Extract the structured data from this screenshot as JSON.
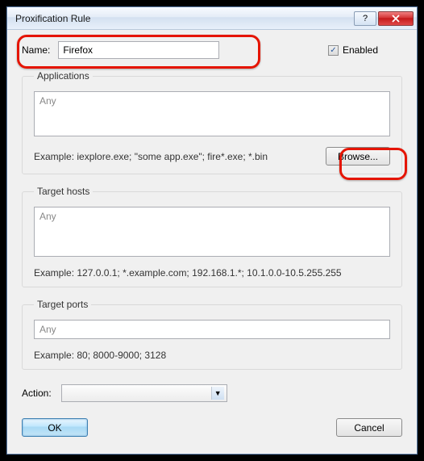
{
  "titlebar": {
    "title": "Proxification Rule"
  },
  "name": {
    "label": "Name:",
    "value": "Firefox"
  },
  "enabled": {
    "label": "Enabled",
    "checked": true
  },
  "applications": {
    "legend": "Applications",
    "value": "Any",
    "example": "Example: iexplore.exe; \"some app.exe\"; fire*.exe; *.bin",
    "browse": "Browse..."
  },
  "targetHosts": {
    "legend": "Target hosts",
    "value": "Any",
    "example": "Example: 127.0.0.1; *.example.com; 192.168.1.*; 10.1.0.0-10.5.255.255"
  },
  "targetPorts": {
    "legend": "Target ports",
    "value": "Any",
    "example": "Example: 80; 8000-9000; 3128"
  },
  "action": {
    "label": "Action:",
    "value": ""
  },
  "buttons": {
    "ok": "OK",
    "cancel": "Cancel"
  }
}
